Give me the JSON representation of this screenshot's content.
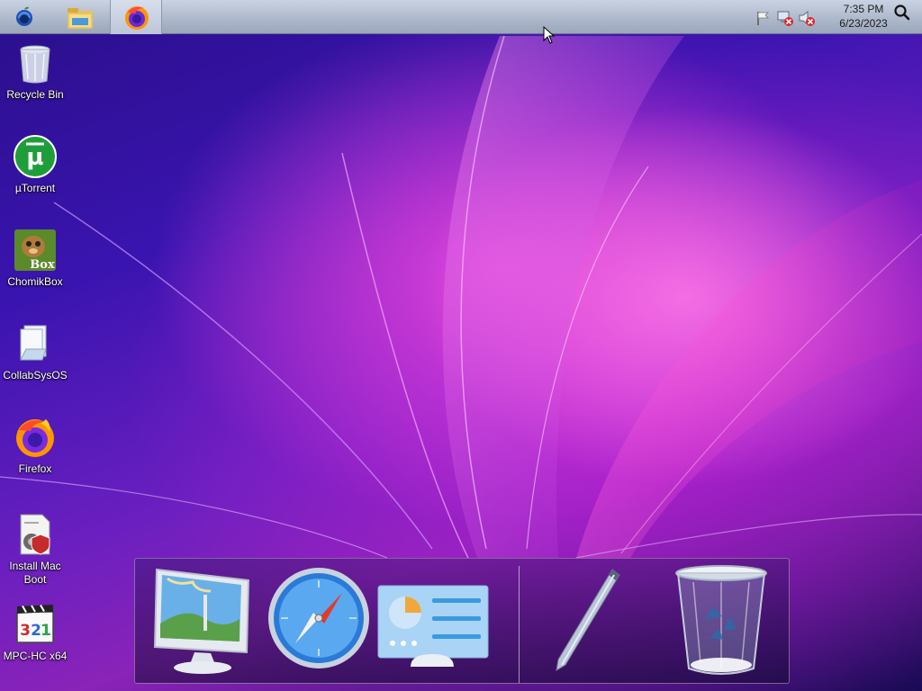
{
  "menubar": {
    "apple_icon": "apple-logo-icon",
    "taskbar": [
      {
        "name": "File Explorer",
        "icon": "folder-icon"
      },
      {
        "name": "Firefox",
        "icon": "firefox-icon",
        "active": true
      }
    ],
    "tray": [
      {
        "icon": "action-center-flag-icon"
      },
      {
        "icon": "network-disconnected-icon"
      },
      {
        "icon": "volume-muted-icon"
      }
    ],
    "clock": {
      "time": "7:35 PM",
      "date": "6/23/2023"
    },
    "search_icon": "search-icon"
  },
  "desktop_icons": [
    {
      "label": "Recycle Bin",
      "icon": "recycle-bin-icon"
    },
    {
      "label": "µTorrent",
      "icon": "utorrent-icon"
    },
    {
      "label": "ChomikBox",
      "icon": "chomikbox-icon"
    },
    {
      "label": "CollabSysOS",
      "icon": "folder-files-icon"
    },
    {
      "label": "Firefox",
      "icon": "firefox-icon"
    },
    {
      "label": "Install Mac Boot",
      "icon": "installer-icon"
    },
    {
      "label": "MPC-HC x64",
      "icon": "mpc-hc-icon"
    }
  ],
  "dock": {
    "items": [
      {
        "icon": "desktop-monitor-icon"
      },
      {
        "icon": "safari-compass-icon"
      },
      {
        "icon": "control-panel-icon"
      },
      {
        "icon": "pen-icon"
      },
      {
        "icon": "trash-icon"
      }
    ]
  },
  "colors": {
    "menubar_top": "#c9d3e3",
    "menubar_bottom": "#9aa6ba",
    "wallpaper_primary": "#3a14b0",
    "wallpaper_accent": "#e046dc"
  }
}
